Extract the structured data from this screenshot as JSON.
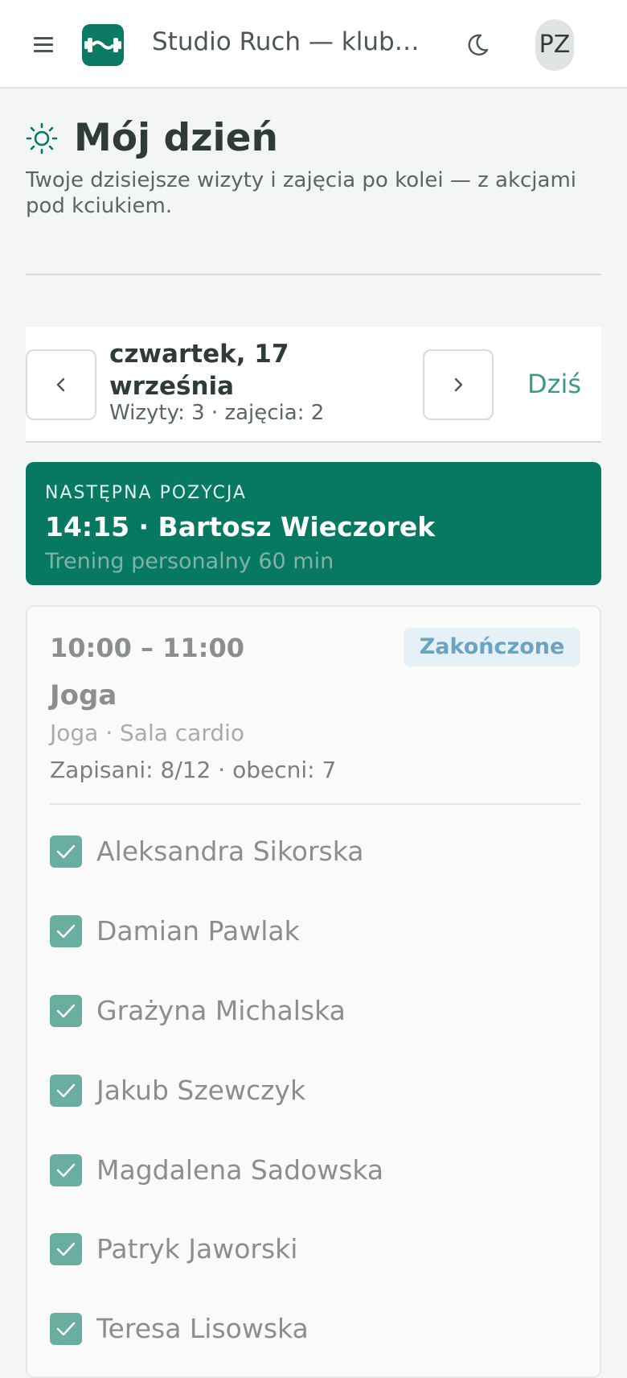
{
  "header": {
    "app_title": "Studio Ruch — klub…",
    "avatar_initials": "PZ"
  },
  "page": {
    "title": "Mój dzień",
    "subtitle": "Twoje dzisiejsze wizyty i zajęcia po kolei — z akcjami pod kciukiem."
  },
  "date_nav": {
    "date_label": "czwartek, 17 września",
    "meta": "Wizyty: 3 · zajęcia: 2",
    "today_label": "Dziś"
  },
  "next_item": {
    "eyebrow": "NASTĘPNA POZYCJA",
    "title": "14:15 · Bartosz Wieczorek",
    "subtitle": "Trening personalny 60 min"
  },
  "class_card": {
    "time": "10:00 – 11:00",
    "status": "Zakończone",
    "name": "Joga",
    "meta": "Joga · Sala cardio",
    "count": "Zapisani: 8/12 · obecni: 7",
    "attendees": [
      {
        "name": "Aleksandra Sikorska",
        "checked": true
      },
      {
        "name": "Damian Pawlak",
        "checked": true
      },
      {
        "name": "Grażyna Michalska",
        "checked": true
      },
      {
        "name": "Jakub Szewczyk",
        "checked": true
      },
      {
        "name": "Magdalena Sadowska",
        "checked": true
      },
      {
        "name": "Patryk Jaworski",
        "checked": true
      },
      {
        "name": "Teresa Lisowska",
        "checked": true
      }
    ]
  },
  "colors": {
    "brand": "#077963",
    "accent_link": "#3d9a84",
    "badge_text": "#6aa4c2",
    "badge_bg": "#e6f1f7",
    "checkbox": "#6aaea0"
  },
  "icons": {
    "menu": "menu-icon",
    "logo": "dumbbell-logo-icon",
    "theme": "moon-icon",
    "heading": "sun-icon",
    "prev": "chevron-left-icon",
    "next": "chevron-right-icon",
    "check": "check-icon"
  }
}
